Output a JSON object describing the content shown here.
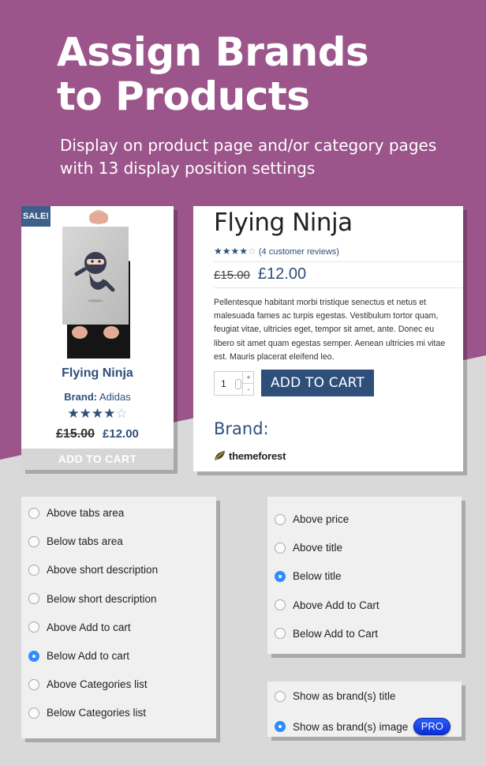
{
  "hero": {
    "title_line1": "Assign Brands",
    "title_line2": "to Products",
    "subtitle_line1": "Display on product page and/or category pages",
    "subtitle_line2": "with 13 display position settings"
  },
  "colors": {
    "purple": "#9b558b",
    "brand_blue": "#2e4f7a",
    "radio_blue": "#2f8cff",
    "panel_bg": "#f0f0f0"
  },
  "shop_card": {
    "badge": "SALE!",
    "name": "Flying Ninja",
    "brand_label": "Brand:",
    "brand_value": "Adidas",
    "rating": 4,
    "rating_max": 5,
    "old_price": "£15.00",
    "new_price": "£12.00",
    "add_to_cart": "ADD TO CART"
  },
  "detail_card": {
    "title": "Flying Ninja",
    "rating": 4,
    "rating_max": 5,
    "reviews": "(4 customer reviews)",
    "old_price": "£15.00",
    "new_price": "£12.00",
    "description": "Pellentesque habitant morbi tristique senectus et netus et malesuada fames ac turpis egestas. Vestibulum tortor quam, feugiat vitae, ultricies eget, tempor sit amet, ante. Donec eu libero sit amet quam egestas semper. Aenean ultricies mi vitae est. Mauris placerat eleifend leo.",
    "qty": "1",
    "qty_up": "+",
    "qty_down": "-",
    "add_to_cart": "ADD TO CART",
    "brand_label": "Brand:",
    "brand_logo_text": "themeforest"
  },
  "panel_a": {
    "options": [
      {
        "label": "Above tabs area",
        "checked": false
      },
      {
        "label": "Below tabs area",
        "checked": false
      },
      {
        "label": "Above short description",
        "checked": false
      },
      {
        "label": "Below short description",
        "checked": false
      },
      {
        "label": "Above Add to cart",
        "checked": false
      },
      {
        "label": "Below Add to cart",
        "checked": true
      },
      {
        "label": "Above Categories list",
        "checked": false
      },
      {
        "label": "Below Categories list",
        "checked": false
      }
    ]
  },
  "panel_b": {
    "options": [
      {
        "label": "Above price",
        "checked": false
      },
      {
        "label": "Above title",
        "checked": false
      },
      {
        "label": "Below title",
        "checked": true
      },
      {
        "label": "Above Add to Cart",
        "checked": false
      },
      {
        "label": "Below Add to Cart",
        "checked": false
      }
    ]
  },
  "panel_c": {
    "options": [
      {
        "label": "Show as brand(s) title",
        "checked": false
      },
      {
        "label": "Show as brand(s) image",
        "checked": true
      }
    ],
    "pro_badge": "PRO"
  }
}
